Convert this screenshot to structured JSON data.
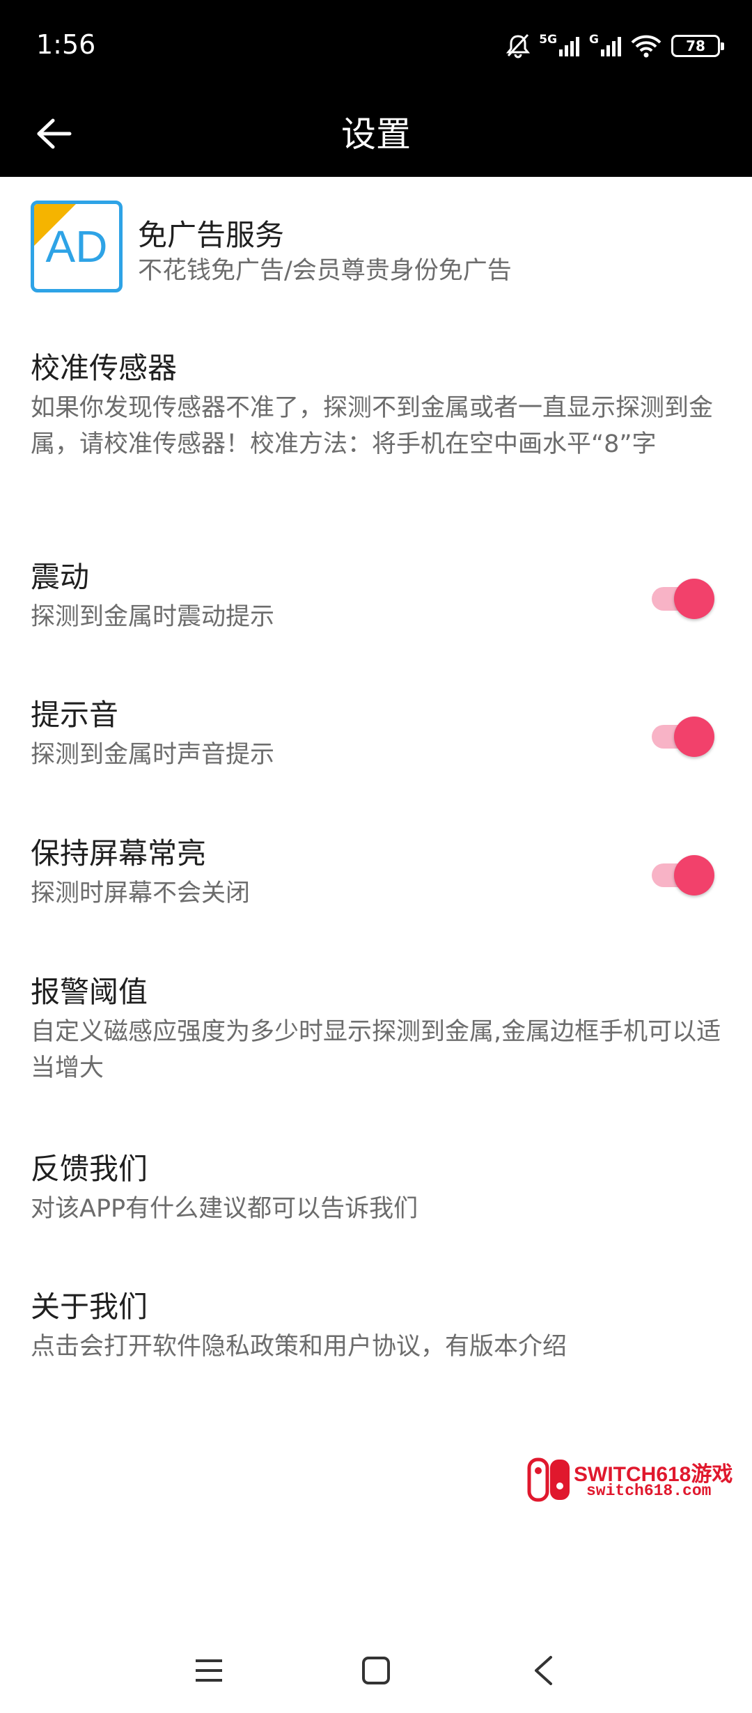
{
  "status_bar": {
    "time": "1:56",
    "network_1": "5G",
    "network_2": "G",
    "battery": "78"
  },
  "app_bar": {
    "title": "设置",
    "back_icon": "arrow-left-icon"
  },
  "ad_service": {
    "badge_text": "AD",
    "title": "免广告服务",
    "subtitle": "不花钱免广告/会员尊贵身份免广告"
  },
  "settings": [
    {
      "title": "校准传感器",
      "subtitle": "如果你发现传感器不准了，探测不到金属或者一直显示探测到金属，请校准传感器！校准方法：将手机在空中画水平“8”字"
    },
    {
      "title": "震动",
      "subtitle": "探测到金属时震动提示",
      "toggle_on": true
    },
    {
      "title": "提示音",
      "subtitle": "探测到金属时声音提示",
      "toggle_on": true
    },
    {
      "title": "保持屏幕常亮",
      "subtitle": "探测时屏幕不会关闭",
      "toggle_on": true
    },
    {
      "title": "报警阈值",
      "subtitle": "自定义磁感应强度为多少时显示探测到金属,金属边框手机可以适当增大"
    },
    {
      "title": "反馈我们",
      "subtitle": "对该APP有什么建议都可以告诉我们"
    },
    {
      "title": "关于我们",
      "subtitle": "点击会打开软件隐私政策和用户协议，有版本介绍"
    }
  ],
  "colors": {
    "accent": "#f2416b",
    "track": "#f8b3c6",
    "ad_blue": "#2ea3e6",
    "ad_corner": "#f5b400",
    "watermark": "#e0182d"
  },
  "watermark": {
    "title": "SWITCH618游戏",
    "url": "switch618.com"
  },
  "nav_bar": {
    "menu_icon": "menu-icon",
    "home_icon": "home-icon",
    "back_icon": "back-chevron-icon"
  }
}
